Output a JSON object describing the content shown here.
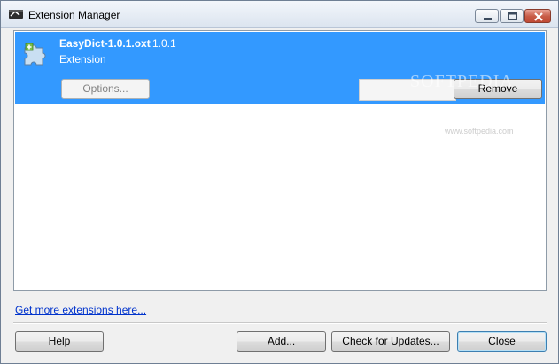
{
  "window": {
    "title": "Extension Manager"
  },
  "extensions": [
    {
      "name": "EasyDict-1.0.1.oxt",
      "version": "1.0.1",
      "description": "Extension",
      "options_label": "Options...",
      "remove_label": "Remove"
    }
  ],
  "links": {
    "get_more": "Get more extensions here..."
  },
  "buttons": {
    "help": "Help",
    "add": "Add...",
    "check_updates": "Check for Updates...",
    "close": "Close"
  },
  "watermark": {
    "text": "SOFTPEDIA",
    "sub": "www.softpedia.com"
  },
  "colors": {
    "selection": "#3399ff",
    "link": "#0033cc",
    "close_control": "#c75a45"
  }
}
